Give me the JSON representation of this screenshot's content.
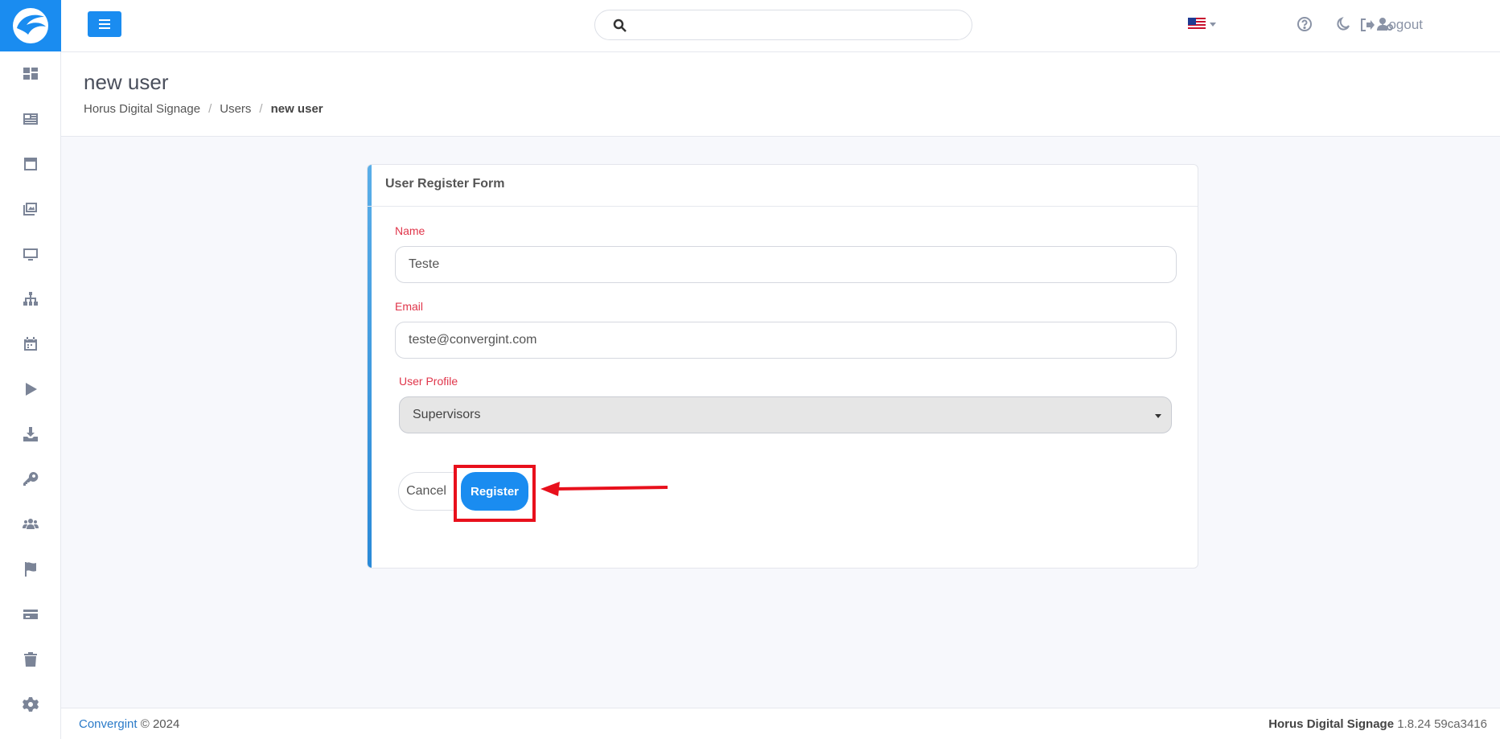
{
  "topbar": {
    "search_placeholder": "",
    "logout_label": "Logout"
  },
  "page": {
    "title": "new user",
    "breadcrumb": [
      "Horus Digital Signage",
      "Users",
      "new user"
    ]
  },
  "form": {
    "title": "User Register Form",
    "name_label": "Name",
    "name_value": "Teste",
    "email_label": "Email",
    "email_value": "teste@convergint.com",
    "profile_label": "User Profile",
    "profile_value": "Supervisors",
    "cancel_label": "Cancel",
    "register_label": "Register"
  },
  "footer": {
    "brand": "Convergint",
    "copyright": "© 2024",
    "app_name": "Horus Digital Signage",
    "version": "1.8.24 59ca3416"
  },
  "colors": {
    "primary": "#1a8cf0",
    "required_label": "#e0354a",
    "annotation": "#e8101c"
  }
}
